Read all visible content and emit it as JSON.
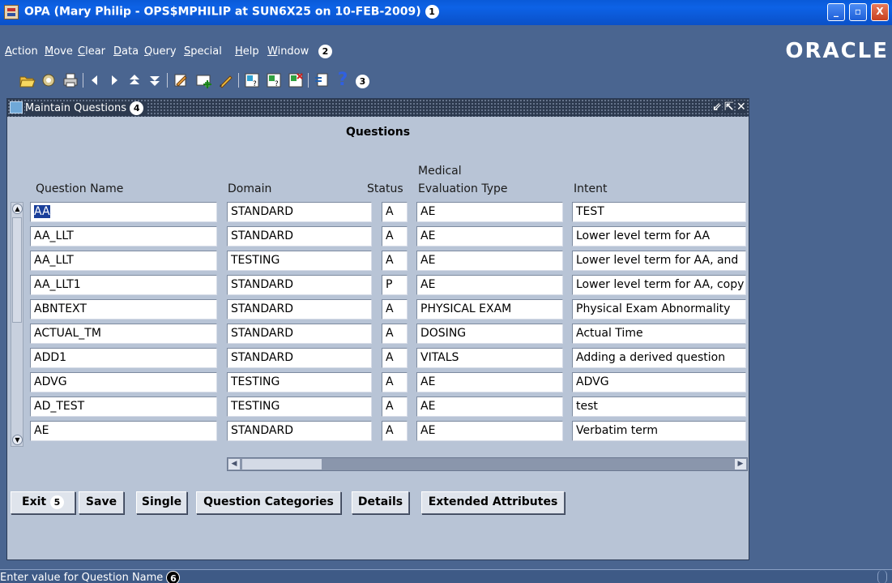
{
  "titlebar": {
    "title": "OPA (Mary Philip - OPS$MPHILIP at SUN6X25 on 10-FEB-2009)",
    "badge": "1",
    "minimize": "_",
    "maximize": "▫",
    "close": "X"
  },
  "menubar": {
    "items": [
      "Action",
      "Move",
      "Clear",
      "Data",
      "Query",
      "Special",
      "Help",
      "Window"
    ],
    "badge": "2",
    "logo": "ORACLE"
  },
  "toolbar": {
    "icons": [
      "open-folder-icon",
      "print-setup-icon",
      "print-icon",
      "previous-record-icon",
      "next-record-icon",
      "previous-block-icon",
      "next-block-icon",
      "edit-icon",
      "insert-record-icon",
      "delete-record-icon",
      "enter-query-icon",
      "execute-query-icon",
      "cancel-query-icon",
      "list-of-values-icon",
      "help-icon"
    ],
    "help_glyph": "?",
    "badge": "3"
  },
  "window": {
    "title": "Maintain Questions",
    "badge": "4",
    "controls": [
      "⇙",
      "⇱",
      "✕"
    ],
    "block_title": "Questions",
    "columns": {
      "question_name": "Question Name",
      "domain": "Domain",
      "status": "Status",
      "medical_1": "Medical",
      "medical_2": "Evaluation Type",
      "intent": "Intent"
    },
    "rows": [
      {
        "name": "AA",
        "domain": "STANDARD",
        "status": "A",
        "eval": "AE",
        "intent": "TEST"
      },
      {
        "name": "AA_LLT",
        "domain": "STANDARD",
        "status": "A",
        "eval": "AE",
        "intent": "Lower level term for AA"
      },
      {
        "name": "AA_LLT",
        "domain": "TESTING",
        "status": "A",
        "eval": "AE",
        "intent": "Lower level term for AA, and"
      },
      {
        "name": "AA_LLT1",
        "domain": "STANDARD",
        "status": "P",
        "eval": "AE",
        "intent": "Lower level term for AA, copy"
      },
      {
        "name": "ABNTEXT",
        "domain": "STANDARD",
        "status": "A",
        "eval": "PHYSICAL EXAM",
        "intent": "Physical Exam Abnormality"
      },
      {
        "name": "ACTUAL_TM",
        "domain": "STANDARD",
        "status": "A",
        "eval": "DOSING",
        "intent": "Actual Time"
      },
      {
        "name": "ADD1",
        "domain": "STANDARD",
        "status": "A",
        "eval": "VITALS",
        "intent": "Adding a derived question"
      },
      {
        "name": "ADVG",
        "domain": "TESTING",
        "status": "A",
        "eval": "AE",
        "intent": "ADVG"
      },
      {
        "name": "AD_TEST",
        "domain": "TESTING",
        "status": "A",
        "eval": "AE",
        "intent": "test"
      },
      {
        "name": "AE",
        "domain": "STANDARD",
        "status": "A",
        "eval": "AE",
        "intent": "Verbatim term"
      }
    ],
    "buttons": {
      "exit": "Exit",
      "exit_badge": "5",
      "save": "Save",
      "single": "Single",
      "categories": "Question Categories",
      "details": "Details",
      "extended": "Extended Attributes"
    }
  },
  "statusbar": {
    "message": "Enter value for Question Name",
    "badge": "6"
  },
  "colors": {
    "background": "#4a6590",
    "titlebar": "#0a5ad8",
    "window": "#b8c4d6",
    "selection": "#1a3f9a"
  }
}
